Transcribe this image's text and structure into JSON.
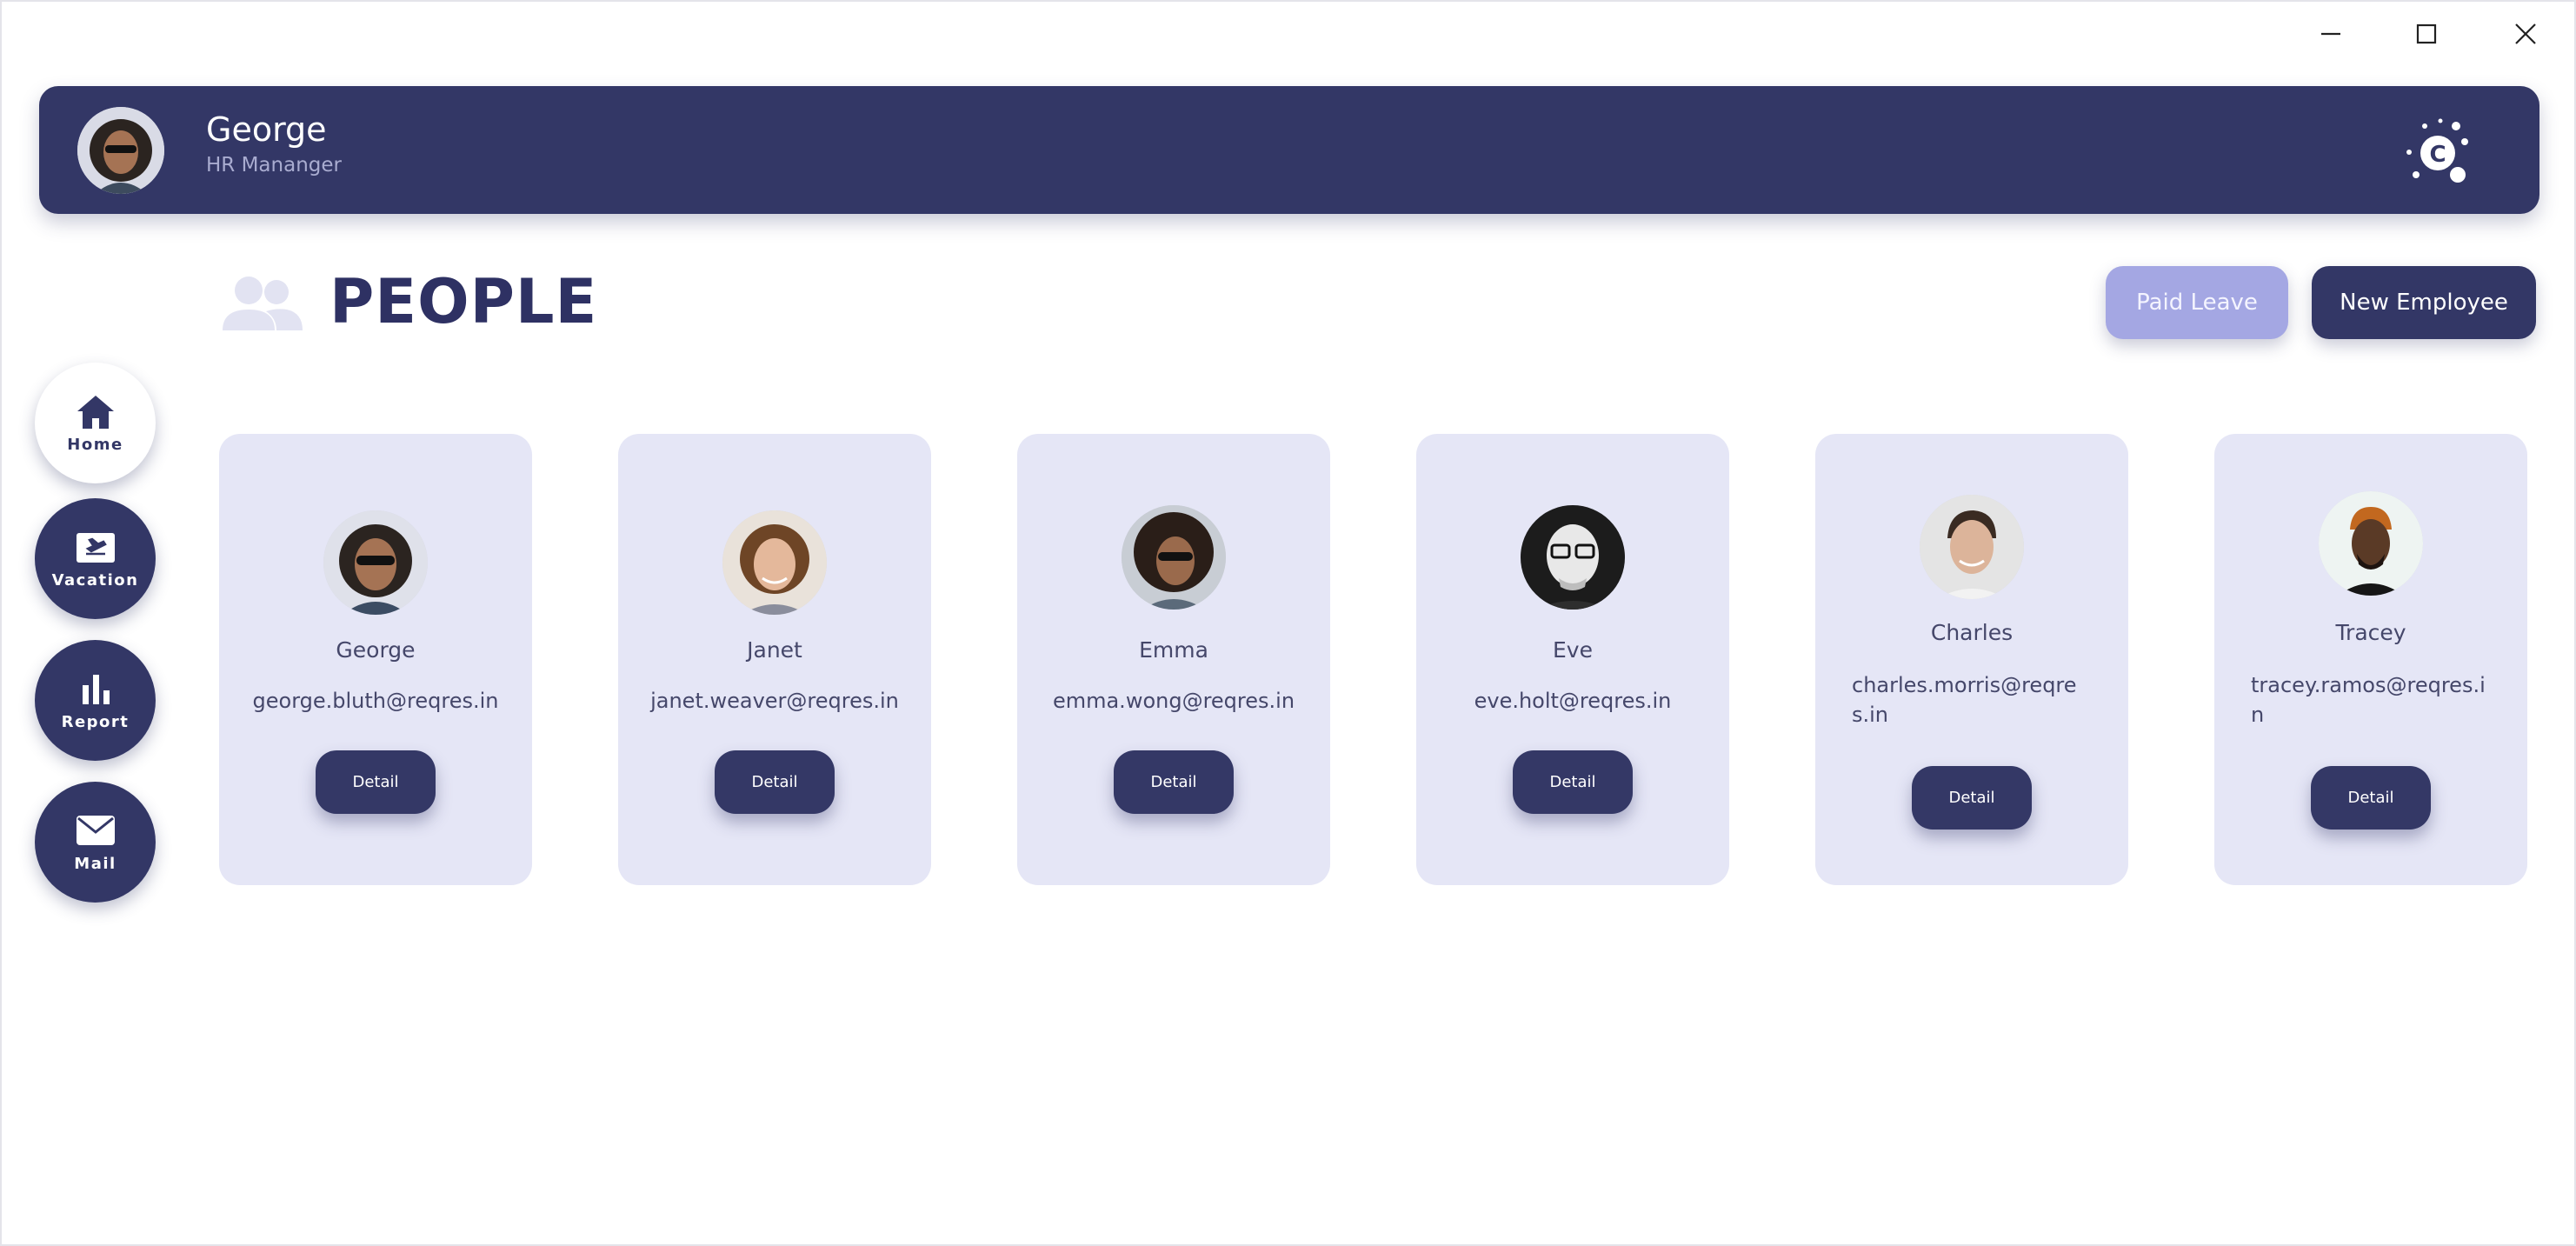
{
  "header": {
    "user_name": "George",
    "user_role": "HR Mananger"
  },
  "page": {
    "title": "PEOPLE",
    "paid_leave_label": "Paid Leave",
    "new_employee_label": "New Employee"
  },
  "nav": {
    "items": [
      {
        "label": "Home",
        "icon": "home-icon",
        "active": true
      },
      {
        "label": "Vacation",
        "icon": "airplane-ticket-icon",
        "active": false
      },
      {
        "label": "Report",
        "icon": "bar-chart-icon",
        "active": false
      },
      {
        "label": "Mail",
        "icon": "mail-icon",
        "active": false
      }
    ]
  },
  "employees": [
    {
      "name": "George",
      "email": "george.bluth@reqres.in",
      "detail_label": "Detail"
    },
    {
      "name": "Janet",
      "email": "janet.weaver@reqres.in",
      "detail_label": "Detail"
    },
    {
      "name": "Emma",
      "email": "emma.wong@reqres.in",
      "detail_label": "Detail"
    },
    {
      "name": "Eve",
      "email": "eve.holt@reqres.in",
      "detail_label": "Detail"
    },
    {
      "name": "Charles",
      "email": "charles.morris@reqres.in",
      "detail_label": "Detail"
    },
    {
      "name": "Tracey",
      "email": "tracey.ramos@reqres.in",
      "detail_label": "Detail"
    }
  ],
  "colors": {
    "primary": "#333766",
    "accent_light": "#a4a7e3",
    "card_background": "#e5e6f6",
    "text": "#2e3163"
  }
}
